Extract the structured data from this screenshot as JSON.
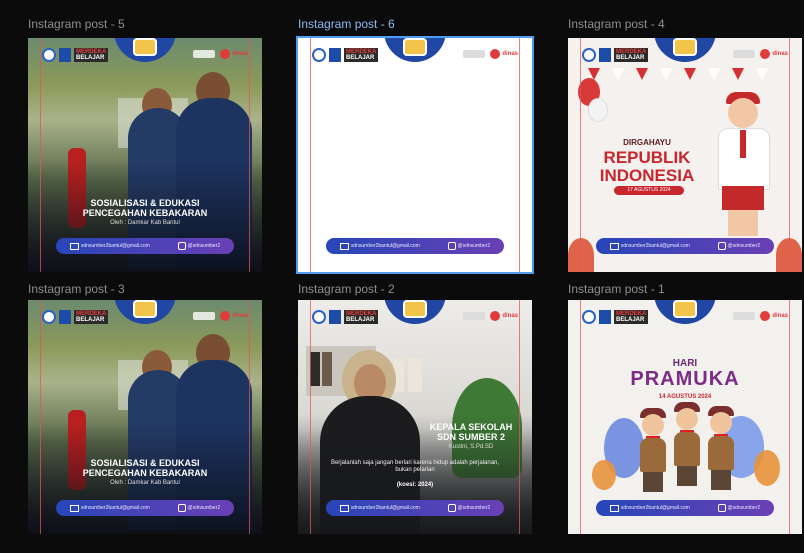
{
  "canvas": {
    "background": "#0b0b0c"
  },
  "frames": [
    {
      "label": "Instagram post - 5",
      "template": "photo",
      "selected": false,
      "headline_1": "SOSIALISASI & EDUKASI",
      "headline_2": "PENCEGAHAN KEBAKARAN",
      "byline": "Oleh : Damkar Kab Bantul"
    },
    {
      "label": "Instagram post - 6",
      "template": "blank",
      "selected": true
    },
    {
      "label": "Instagram post - 4",
      "template": "republik",
      "selected": false,
      "line_1": "DIRGAHAYU",
      "line_2": "REPUBLIK",
      "line_3": "INDONESIA",
      "date": "17 AGUSTUS 2024"
    },
    {
      "label": "Instagram post - 3",
      "template": "photo",
      "selected": false,
      "headline_1": "SOSIALISASI & EDUKASI",
      "headline_2": "PENCEGAHAN KEBAKARAN",
      "byline": "Oleh : Damkar Kab Bantul"
    },
    {
      "label": "Instagram post - 2",
      "template": "kepala",
      "selected": false,
      "title_1": "KEPALA SEKOLAH",
      "title_2": "SDN SUMBER 2",
      "name": "Kustini, S.Pd.SD",
      "quote": "Berjalanlah saja jangan berlari karena hidup adalah perjalanan, bukan pelarian",
      "source": "(koesi: 2024)"
    },
    {
      "label": "Instagram post - 1",
      "template": "pramuka",
      "selected": false,
      "hari": "HARI",
      "title": "PRAMUKA",
      "date": "14 AGUSTUS 2024"
    }
  ],
  "branding": {
    "merdeka_1": "MERDEKA",
    "merdeka_2": "BELAJAR",
    "dinas": "dinas"
  },
  "contact": {
    "email": "sdnsumber2bantul@gmail.com",
    "instagram": "@sdnsumber2"
  },
  "colors": {
    "selection": "#4e9df0",
    "guide": "#e25555",
    "brand_blue": "#1f47a3",
    "red": "#c7272d",
    "purple": "#7b2c85"
  }
}
